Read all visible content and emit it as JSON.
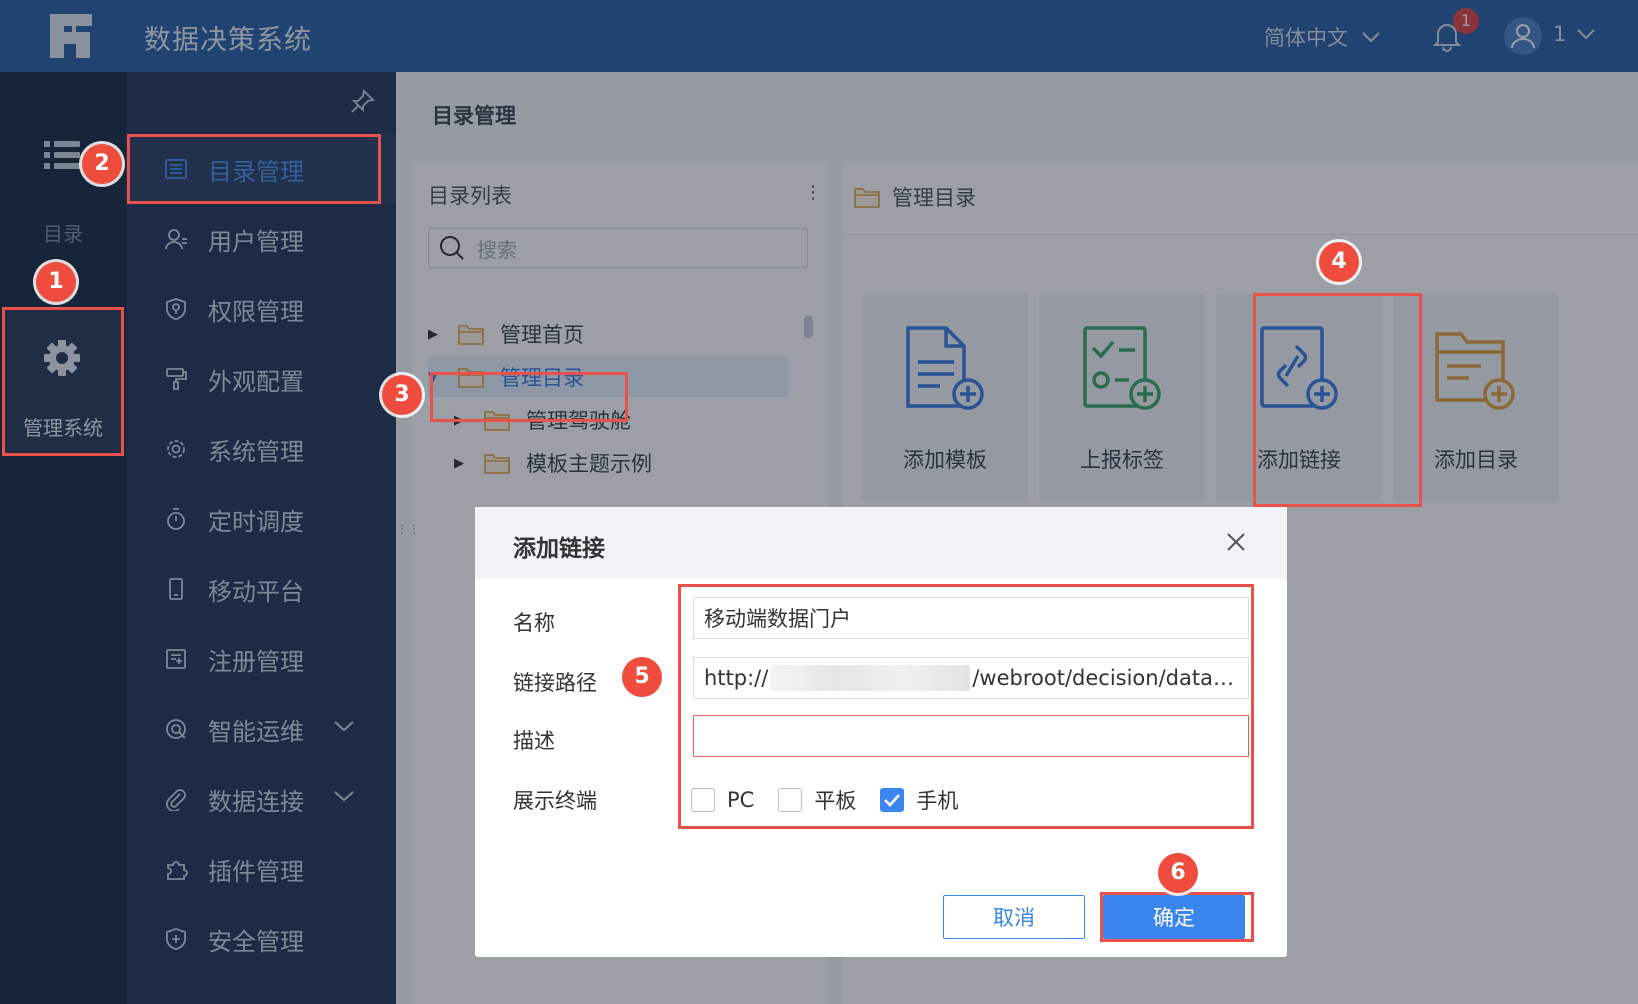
{
  "header": {
    "app_title": "数据决策系统",
    "language": "简体中文",
    "notification_count": "1",
    "user_name": "1",
    "brand_color": "#2b5fa4"
  },
  "rail": {
    "catalog_label": "目录",
    "admin_label": "管理系统"
  },
  "menu": {
    "items": [
      {
        "label": "目录管理",
        "icon": "list-icon"
      },
      {
        "label": "用户管理",
        "icon": "user-icon"
      },
      {
        "label": "权限管理",
        "icon": "shield-key-icon"
      },
      {
        "label": "外观配置",
        "icon": "paint-roller-icon"
      },
      {
        "label": "系统管理",
        "icon": "gear-icon"
      },
      {
        "label": "定时调度",
        "icon": "stopwatch-icon"
      },
      {
        "label": "移动平台",
        "icon": "mobile-icon"
      },
      {
        "label": "注册管理",
        "icon": "register-icon"
      },
      {
        "label": "智能运维",
        "icon": "ops-icon"
      },
      {
        "label": "数据连接",
        "icon": "paperclip-icon"
      },
      {
        "label": "插件管理",
        "icon": "puzzle-icon"
      },
      {
        "label": "安全管理",
        "icon": "shield-plus-icon"
      }
    ]
  },
  "main": {
    "title": "目录管理",
    "tree": {
      "header": "目录列表",
      "search_placeholder": "搜索",
      "nodes": [
        {
          "label": "管理首页"
        },
        {
          "label": "管理目录"
        },
        {
          "label": "管理驾驶舱"
        },
        {
          "label": "模板主题示例"
        }
      ]
    },
    "directory": {
      "header": "管理目录",
      "cards": [
        {
          "label": "添加模板",
          "icon": "add-template-icon",
          "color": "#3a7be0"
        },
        {
          "label": "上报标签",
          "icon": "add-report-tag-icon",
          "color": "#3aa66a"
        },
        {
          "label": "添加链接",
          "icon": "add-link-icon",
          "color": "#3a7be0"
        },
        {
          "label": "添加目录",
          "icon": "add-folder-icon",
          "color": "#e0a040"
        }
      ]
    }
  },
  "dialog": {
    "title": "添加链接",
    "name_label": "名称",
    "name_value": "移动端数据门户",
    "path_label": "链接路径",
    "path_prefix": "http://",
    "path_suffix": "/webroot/decision/data…",
    "desc_label": "描述",
    "desc_value": "",
    "terminal_label": "展示终端",
    "terminals": [
      {
        "label": "PC",
        "checked": false
      },
      {
        "label": "平板",
        "checked": false
      },
      {
        "label": "手机",
        "checked": true
      }
    ],
    "cancel_label": "取消",
    "ok_label": "确定",
    "accent_color": "#3b85ee"
  },
  "annotations": {
    "steps": [
      "1",
      "2",
      "3",
      "4",
      "5",
      "6"
    ],
    "highlight_color": "#e8524a"
  }
}
